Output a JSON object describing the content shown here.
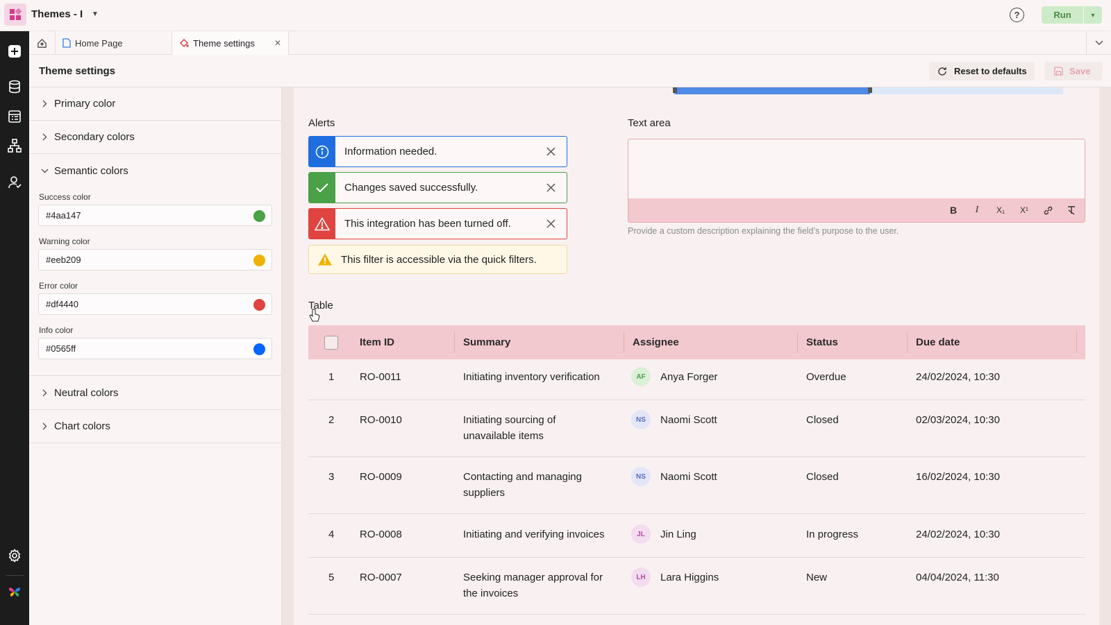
{
  "app": {
    "title": "Themes - I"
  },
  "topbar": {
    "help_label": "?",
    "run_label": "Run"
  },
  "tabs": [
    {
      "label": "Home Page"
    },
    {
      "label": "Theme settings"
    }
  ],
  "page": {
    "title": "Theme settings",
    "reset_label": "Reset to defaults",
    "save_label": "Save"
  },
  "panel": {
    "sections": {
      "primary": "Primary color",
      "secondary": "Secondary colors",
      "semantic": "Semantic colors",
      "neutral": "Neutral colors",
      "chart": "Chart colors"
    },
    "semantic_fields": [
      {
        "label": "Success color",
        "value": "#4aa147",
        "swatch": "#4aa147"
      },
      {
        "label": "Warning color",
        "value": "#eeb209",
        "swatch": "#eeb209"
      },
      {
        "label": "Error color",
        "value": "#df4440",
        "swatch": "#df4440"
      },
      {
        "label": "Info color",
        "value": "#0565ff",
        "swatch": "#0565ff"
      }
    ]
  },
  "alerts": {
    "heading": "Alerts",
    "items": [
      {
        "type": "info",
        "text": "Information needed."
      },
      {
        "type": "success",
        "text": "Changes saved successfully."
      },
      {
        "type": "error",
        "text": "This integration has been turned off."
      },
      {
        "type": "warning",
        "text": "This filter is accessible via the quick filters."
      }
    ]
  },
  "textarea": {
    "heading": "Text area",
    "help": "Provide a custom description explaining the field’s purpose to the user.",
    "toolbar": [
      "B",
      "I",
      "X₁",
      "X¹",
      "link",
      "clear-format"
    ]
  },
  "table": {
    "heading": "Table",
    "columns": [
      "Item ID",
      "Summary",
      "Assignee",
      "Status",
      "Due date"
    ],
    "rows": [
      {
        "num": "1",
        "id": "RO-0011",
        "summary": [
          "Initiating inventory verification"
        ],
        "initials": "AF",
        "assignee": "Anya Forger",
        "status": "Overdue",
        "due": "24/02/2024, 10:30",
        "avatar_bg": "#dcf0d8",
        "avatar_fg": "#4aa147"
      },
      {
        "num": "2",
        "id": "RO-0010",
        "summary": [
          "Initiating sourcing of",
          "unavailable items"
        ],
        "initials": "NS",
        "assignee": "Naomi Scott",
        "status": "Closed",
        "due": "02/03/2024, 10:30",
        "avatar_bg": "#e2e6f6",
        "avatar_fg": "#5b6bbf"
      },
      {
        "num": "3",
        "id": "RO-0009",
        "summary": [
          "Contacting and managing",
          "suppliers"
        ],
        "initials": "NS",
        "assignee": "Naomi Scott",
        "status": "Closed",
        "due": "16/02/2024, 10:30",
        "avatar_bg": "#e2e6f6",
        "avatar_fg": "#5b6bbf"
      },
      {
        "num": "4",
        "id": "RO-0008",
        "summary": [
          "Initiating and verifying invoices"
        ],
        "initials": "JL",
        "assignee": "Jin Ling",
        "status": "In progress",
        "due": "24/02/2024, 10:30",
        "avatar_bg": "#f3dcef",
        "avatar_fg": "#b04ea0"
      },
      {
        "num": "5",
        "id": "RO-0007",
        "summary": [
          "Seeking manager approval for",
          "the invoices"
        ],
        "initials": "LH",
        "assignee": "Lara Higgins",
        "status": "New",
        "due": "04/04/2024, 11:30",
        "avatar_bg": "#f3dcef",
        "avatar_fg": "#b04ea0"
      }
    ]
  }
}
